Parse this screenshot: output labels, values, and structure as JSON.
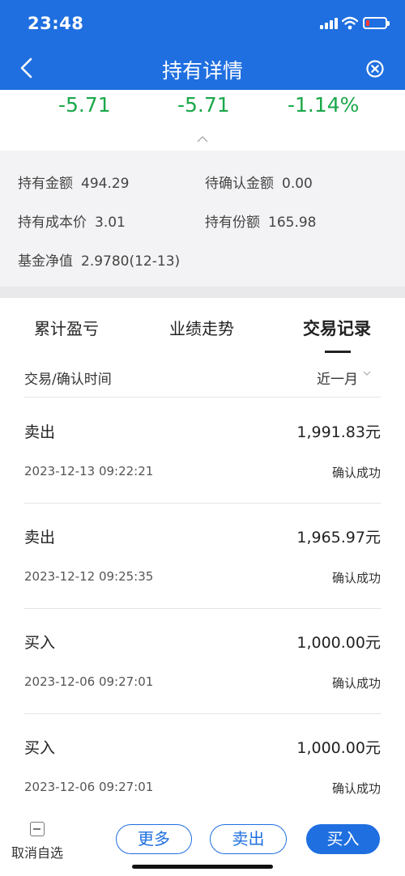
{
  "status_bar": {
    "time": "23:48"
  },
  "nav": {
    "title": "持有详情"
  },
  "pnl": [
    "-5.71",
    "-5.71",
    "-1.14%"
  ],
  "summary": {
    "holding_amount_label": "持有金额",
    "holding_amount": "494.29",
    "pending_label": "待确认金额",
    "pending": "0.00",
    "cost_label": "持有成本价",
    "cost": "3.01",
    "shares_label": "持有份额",
    "shares": "165.98",
    "nav_label": "基金净值",
    "nav_value": "2.9780(12-13)"
  },
  "tabs": [
    "累计盈亏",
    "业绩走势",
    "交易记录"
  ],
  "list_header": {
    "label": "交易/确认时间",
    "filter": "近一月"
  },
  "transactions": [
    {
      "type": "卖出",
      "amount": "1,991.83元",
      "time": "2023-12-13 09:22:21",
      "status": "确认成功"
    },
    {
      "type": "卖出",
      "amount": "1,965.97元",
      "time": "2023-12-12 09:25:35",
      "status": "确认成功"
    },
    {
      "type": "买入",
      "amount": "1,000.00元",
      "time": "2023-12-06 09:27:01",
      "status": "确认成功"
    },
    {
      "type": "买入",
      "amount": "1,000.00元",
      "time": "2023-12-06 09:27:01",
      "status": "确认成功"
    }
  ],
  "bottom": {
    "unwatch": "取消自选",
    "more": "更多",
    "sell": "卖出",
    "buy": "买入"
  },
  "colors": {
    "brand": "#1f6fe0",
    "loss": "#1aa84a"
  }
}
